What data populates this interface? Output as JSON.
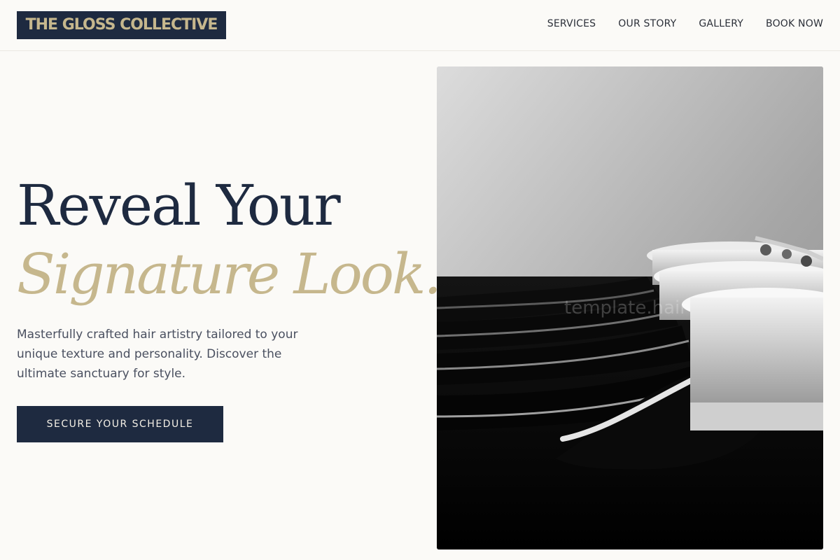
{
  "brand": {
    "name": "THE GLOSS COLLECTIVE"
  },
  "nav": {
    "items": [
      "SERVICES",
      "OUR STORY",
      "GALLERY",
      "BOOK NOW"
    ]
  },
  "hero": {
    "title_line1": "Reveal Your",
    "title_line2": "Signature Look.",
    "description": "Masterfully crafted hair artistry tailored to your unique texture and personality. Discover the ultimate sanctuary for style.",
    "cta_label": "SECURE YOUR SCHEDULE",
    "image_watermark": "template.hair"
  },
  "colors": {
    "navy": "#1e2a40",
    "gold": "#c6b78d",
    "background": "#fbfaf7",
    "body_text": "#4a5060"
  },
  "image": {
    "subject": "black and white salon wash basins and chairs"
  }
}
